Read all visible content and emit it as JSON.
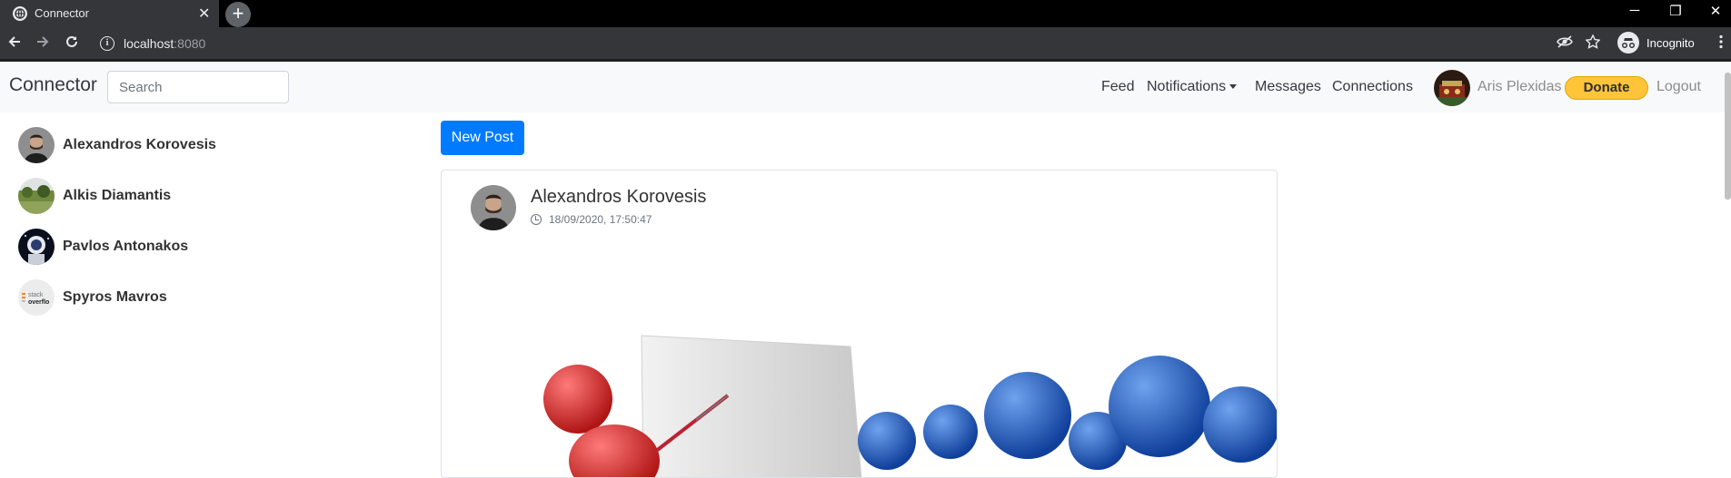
{
  "browser": {
    "tab_title": "Connector",
    "tab_close": "✕",
    "new_tab": "+",
    "url_host": "localhost",
    "url_port": ":8080",
    "incognito_label": "Incognito",
    "window_controls": {
      "minimize": "─",
      "restore": "❐",
      "close": "✕"
    }
  },
  "navbar": {
    "brand": "Connector",
    "search_placeholder": "Search",
    "links": {
      "feed": "Feed",
      "notifications": "Notifications",
      "messages": "Messages",
      "connections": "Connections"
    },
    "user_name": "Aris Plexidas",
    "donate": "Donate",
    "logout": "Logout"
  },
  "sidebar": {
    "contacts": [
      {
        "name": "Alexandros Korovesis",
        "avatar": "person-photo"
      },
      {
        "name": "Alkis Diamantis",
        "avatar": "landscape-photo"
      },
      {
        "name": "Pavlos Antonakos",
        "avatar": "astronaut-photo"
      },
      {
        "name": "Spyros Mavros",
        "avatar": "stackoverflow-logo"
      }
    ]
  },
  "main": {
    "new_post": "New Post",
    "post": {
      "author": "Alexandros Korovesis",
      "timestamp": "18/09/2020, 17:50:47",
      "image": "presentation-3d-figures"
    }
  },
  "colors": {
    "primary": "#007bff",
    "donate": "#ffc439",
    "navbar_bg": "#f8f9fa",
    "chrome_bg": "#35363a"
  }
}
